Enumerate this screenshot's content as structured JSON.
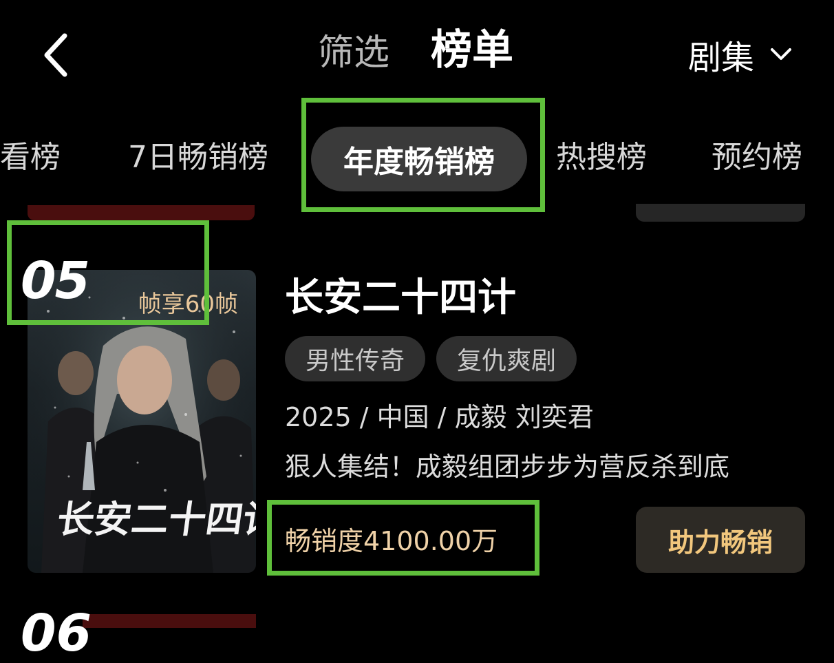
{
  "header": {
    "tabs": [
      {
        "label": "筛选",
        "active": false
      },
      {
        "label": "榜单",
        "active": true
      }
    ],
    "type_select": "剧集"
  },
  "categories": [
    {
      "label": "必看榜",
      "visible_text": "看榜",
      "active": false
    },
    {
      "label": "7日畅销榜",
      "active": false
    },
    {
      "label": "年度畅销榜",
      "active": true
    },
    {
      "label": "热搜榜",
      "active": false
    },
    {
      "label": "预约榜",
      "active": false
    }
  ],
  "items": [
    {
      "rank": "05",
      "poster_badge": "帧享60帧",
      "poster_title": "长安二十四计",
      "title": "长安二十四计",
      "tags": [
        "男性传奇",
        "复仇爽剧"
      ],
      "meta": "2025 / 中国 / 成毅 刘奕君",
      "description": "狠人集结！成毅组团步步为营反杀到底",
      "sales": "畅销度4100.00万",
      "boost_button": "助力畅销"
    }
  ],
  "next_rank": "06",
  "colors": {
    "background": "#000000",
    "highlight_box": "#5fbf3b",
    "sales_text": "#f0d2a8",
    "boost_text": "#f2c77d"
  }
}
